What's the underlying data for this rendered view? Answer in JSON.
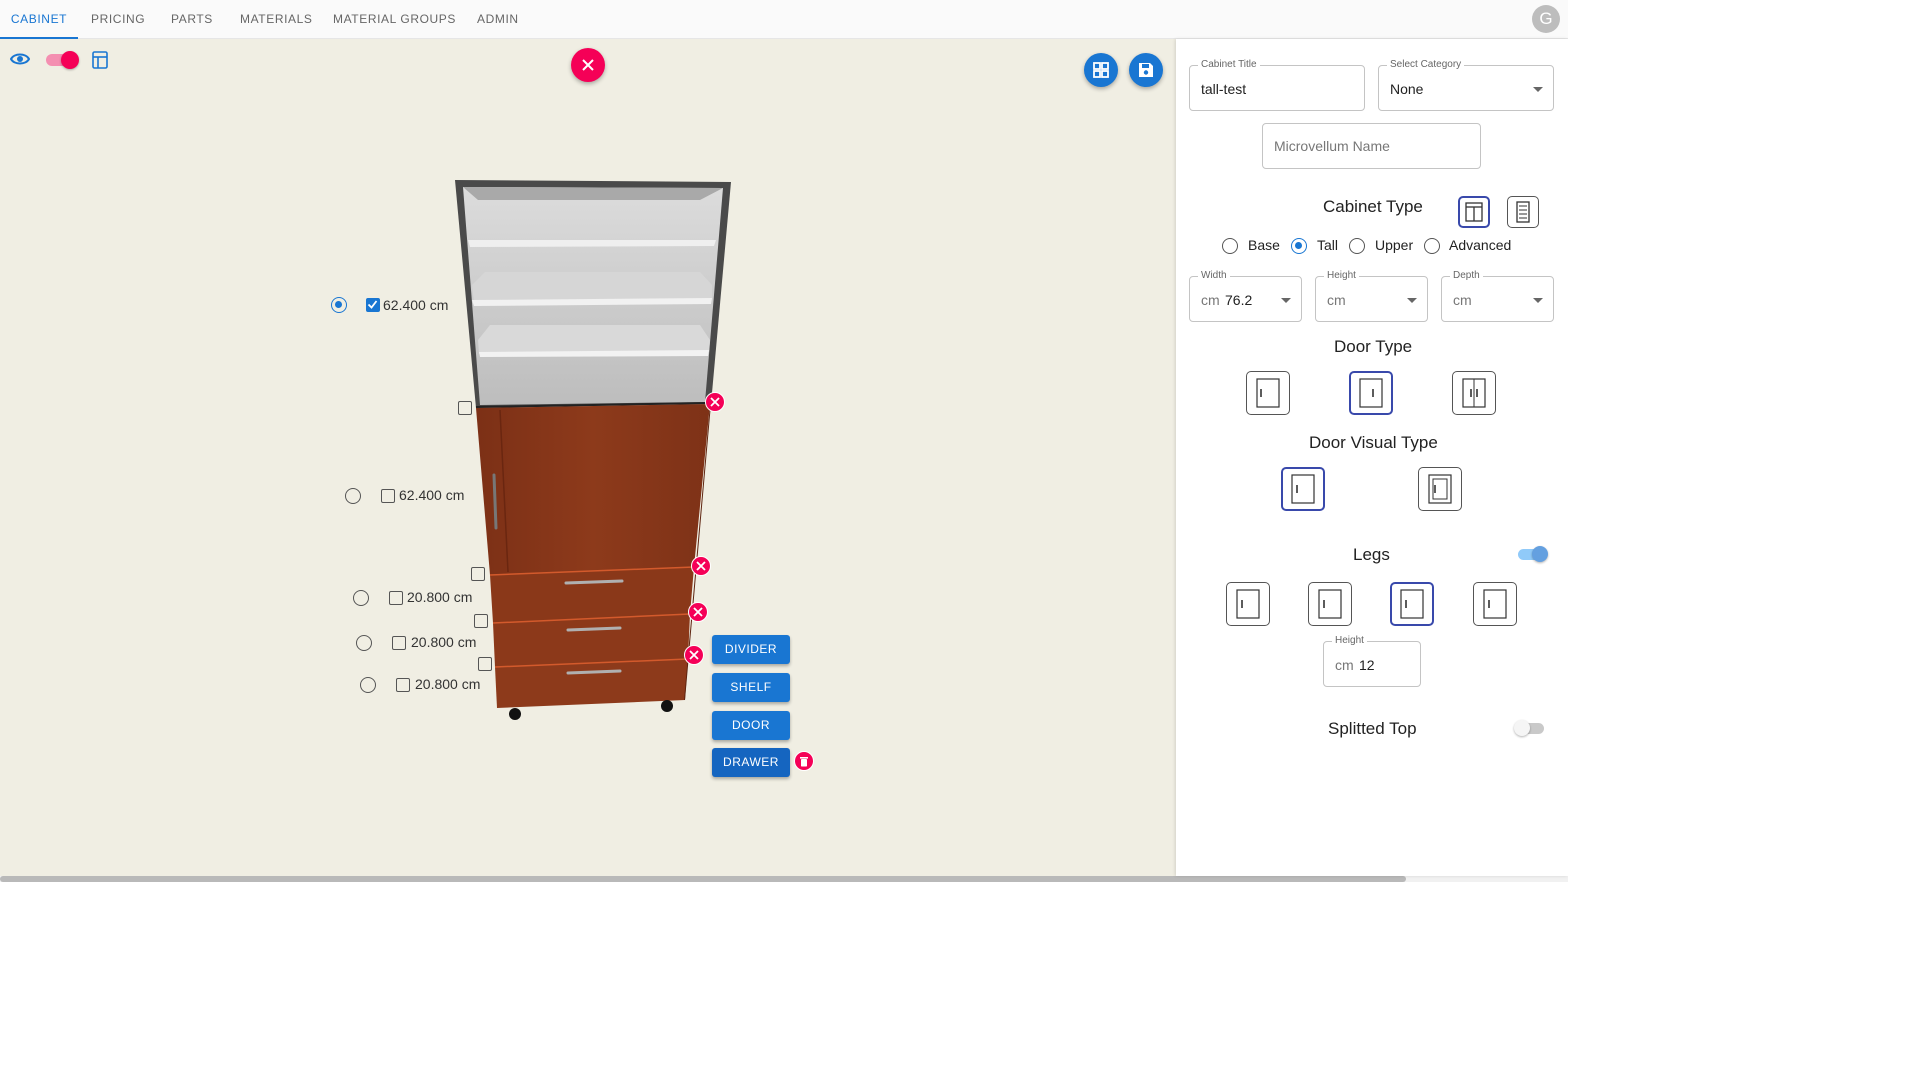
{
  "nav": {
    "tabs": [
      "CABINET",
      "PRICING",
      "PARTS",
      "MATERIALS",
      "MATERIAL GROUPS",
      "ADMIN"
    ],
    "active_tab": "CABINET",
    "avatar_letter": "G"
  },
  "canvas": {
    "sections": [
      {
        "value": "62.400 cm",
        "radio_selected": true,
        "checkbox_checked": true
      },
      {
        "value": "62.400 cm",
        "radio_selected": false,
        "checkbox_checked": false
      },
      {
        "value": "20.800 cm",
        "radio_selected": false,
        "checkbox_checked": false
      },
      {
        "value": "20.800 cm",
        "radio_selected": false,
        "checkbox_checked": false
      },
      {
        "value": "20.800 cm",
        "radio_selected": false,
        "checkbox_checked": false
      }
    ],
    "add_buttons": [
      "DIVIDER",
      "SHELF",
      "DOOR",
      "DRAWER"
    ],
    "colors": {
      "background": "#f0eee3",
      "door": "#8c3a1c",
      "shelf": "#c9c9c9",
      "accent_pink": "#f50057"
    }
  },
  "panel": {
    "cabinet_title": {
      "label": "Cabinet Title",
      "value": "tall-test"
    },
    "category": {
      "label": "Select Category",
      "value": "None"
    },
    "microvellum": {
      "placeholder": "Microvellum Name"
    },
    "cabinet_type": {
      "heading": "Cabinet Type",
      "options": [
        "Base",
        "Tall",
        "Upper",
        "Advanced"
      ],
      "selected": "Tall"
    },
    "dimensions": {
      "width": {
        "label": "Width",
        "unit": "cm",
        "value": "76.2"
      },
      "height": {
        "label": "Height",
        "unit": "cm",
        "value": ""
      },
      "depth": {
        "label": "Depth",
        "unit": "cm",
        "value": ""
      }
    },
    "door_type": {
      "heading": "Door Type",
      "selected_index": 1
    },
    "door_visual_type": {
      "heading": "Door Visual Type",
      "selected_index": 0
    },
    "legs": {
      "heading": "Legs",
      "enabled": true,
      "selected_index": 2,
      "height": {
        "label": "Height",
        "unit": "cm",
        "value": "12"
      }
    },
    "splitted_top": {
      "heading": "Splitted Top",
      "enabled": false
    }
  }
}
